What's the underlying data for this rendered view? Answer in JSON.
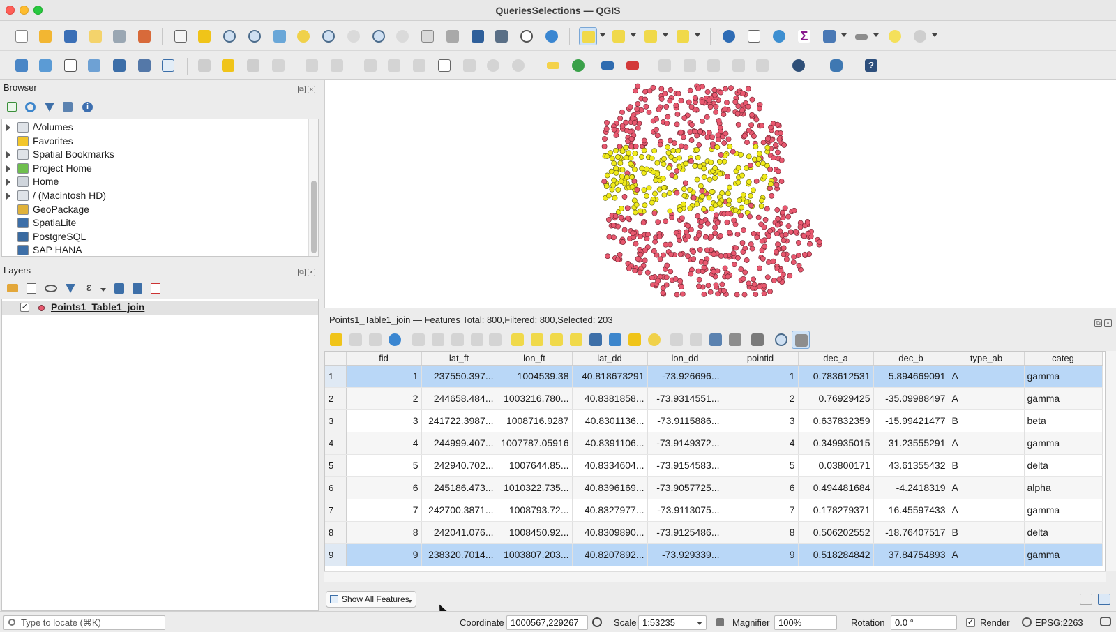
{
  "window": {
    "title": "QueriesSelections — QGIS"
  },
  "browser": {
    "title": "Browser",
    "items": [
      {
        "label": "/Volumes",
        "expandable": true,
        "icon": "folder-icon"
      },
      {
        "label": "Favorites",
        "expandable": false,
        "icon": "star-icon"
      },
      {
        "label": "Spatial Bookmarks",
        "expandable": true,
        "icon": "folder-icon"
      },
      {
        "label": "Project Home",
        "expandable": true,
        "icon": "project-folder-icon"
      },
      {
        "label": "Home",
        "expandable": true,
        "icon": "home-icon"
      },
      {
        "label": "/ (Macintosh HD)",
        "expandable": true,
        "icon": "folder-icon"
      },
      {
        "label": "GeoPackage",
        "expandable": false,
        "icon": "geopackage-icon"
      },
      {
        "label": "SpatiaLite",
        "expandable": false,
        "icon": "spatialite-icon"
      },
      {
        "label": "PostgreSQL",
        "expandable": false,
        "icon": "postgresql-icon"
      },
      {
        "label": "SAP HANA",
        "expandable": false,
        "icon": "sap-hana-icon"
      }
    ]
  },
  "layers": {
    "title": "Layers",
    "items": [
      {
        "label": "Points1_Table1_join",
        "checked": true,
        "symbol_color": "#e8586f"
      }
    ]
  },
  "map": {
    "unselected_color": "#e8586f",
    "selected_color": "#f0ea1a"
  },
  "attribute_table": {
    "title": "Points1_Table1_join — Features Total: 800,Filtered: 800,Selected: 203",
    "columns": [
      "fid",
      "lat_ft",
      "lon_ft",
      "lat_dd",
      "lon_dd",
      "pointid",
      "dec_a",
      "dec_b",
      "type_ab",
      "categ"
    ],
    "rows": [
      {
        "n": "1",
        "selected": true,
        "cells": [
          "1",
          "237550.397...",
          "1004539.38",
          "40.818673291",
          "-73.926696...",
          "1",
          "0.783612531",
          "5.894669091",
          "A",
          "gamma"
        ]
      },
      {
        "n": "2",
        "selected": false,
        "cells": [
          "2",
          "244658.484...",
          "1003216.780...",
          "40.8381858...",
          "-73.9314551...",
          "2",
          "0.76929425",
          "-35.09988497",
          "A",
          "gamma"
        ]
      },
      {
        "n": "3",
        "selected": false,
        "cells": [
          "3",
          "241722.3987...",
          "1008716.9287",
          "40.8301136...",
          "-73.9115886...",
          "3",
          "0.637832359",
          "-15.99421477",
          "B",
          "beta"
        ]
      },
      {
        "n": "4",
        "selected": false,
        "cells": [
          "4",
          "244999.407...",
          "1007787.05916",
          "40.8391106...",
          "-73.9149372...",
          "4",
          "0.349935015",
          "31.23555291",
          "A",
          "gamma"
        ]
      },
      {
        "n": "5",
        "selected": false,
        "cells": [
          "5",
          "242940.702...",
          "1007644.85...",
          "40.8334604...",
          "-73.9154583...",
          "5",
          "0.03800171",
          "43.61355432",
          "B",
          "delta"
        ]
      },
      {
        "n": "6",
        "selected": false,
        "cells": [
          "6",
          "245186.473...",
          "1010322.735...",
          "40.8396169...",
          "-73.9057725...",
          "6",
          "0.494481684",
          "-4.2418319",
          "A",
          "alpha"
        ]
      },
      {
        "n": "7",
        "selected": false,
        "cells": [
          "7",
          "242700.3871...",
          "1008793.72...",
          "40.8327977...",
          "-73.9113075...",
          "7",
          "0.178279371",
          "16.45597433",
          "A",
          "gamma"
        ]
      },
      {
        "n": "8",
        "selected": false,
        "cells": [
          "8",
          "242041.076...",
          "1008450.92...",
          "40.8309890...",
          "-73.9125486...",
          "8",
          "0.506202552",
          "-18.76407517",
          "B",
          "delta"
        ]
      },
      {
        "n": "9",
        "selected": true,
        "cells": [
          "9",
          "238320.7014...",
          "1003807.203...",
          "40.8207892...",
          "-73.929339...",
          "9",
          "0.518284842",
          "37.84754893",
          "A",
          "gamma"
        ]
      }
    ],
    "show_all_label": "Show All Features"
  },
  "statusbar": {
    "locate_placeholder": "Type to locate (⌘K)",
    "coordinate_label": "Coordinate",
    "coordinate_value": "1000567,229267",
    "scale_label": "Scale",
    "scale_value": "1:53235",
    "magnifier_label": "Magnifier",
    "magnifier_value": "100%",
    "rotation_label": "Rotation",
    "rotation_value": "0.0 °",
    "render_label": "Render",
    "crs_label": "EPSG:2263"
  }
}
